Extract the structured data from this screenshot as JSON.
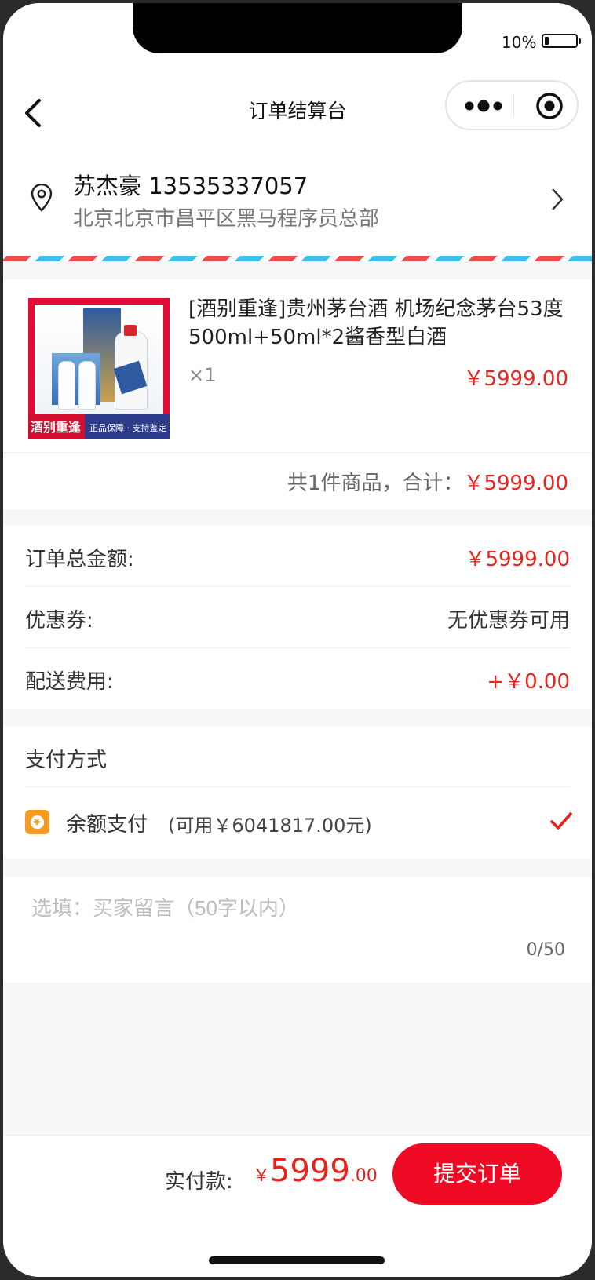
{
  "status": {
    "battery_percent": "10%"
  },
  "nav": {
    "title": "订单结算台"
  },
  "address": {
    "name_phone": "苏杰豪 13535337057",
    "detail": "北京北京市昌平区黑马程序员总部"
  },
  "product": {
    "image_logo_text": "酒别重逢",
    "image_slogan": "正品保障 · 支持鉴定",
    "title": "[酒别重逢]贵州茅台酒 机场纪念茅台53度500ml+50ml*2酱香型白酒",
    "quantity": "×1",
    "price": "￥5999.00"
  },
  "subtotal": {
    "label": "共1件商品，合计：",
    "amount": "￥5999.00"
  },
  "summary": {
    "rows": [
      {
        "label": "订单总金额:",
        "value": "￥5999.00"
      },
      {
        "label": "优惠券:",
        "value": "无优惠券可用"
      },
      {
        "label": "配送费用:",
        "value": "+￥0.00"
      }
    ]
  },
  "payment": {
    "title": "支付方式",
    "method_label": "余额支付",
    "balance_text": "(可用￥6041817.00元)",
    "icon": "wallet-icon",
    "selected": true
  },
  "message": {
    "placeholder": "选填：买家留言（50字以内）",
    "counter": "0/50"
  },
  "footer": {
    "total_label": "实付款:",
    "currency": "￥",
    "total_integer": "5999",
    "total_decimal": ".00",
    "submit_label": "提交订单"
  },
  "colors": {
    "accent_red": "#ee0a24",
    "price_red": "#e8231c",
    "wallet_orange": "#f59a23",
    "airmail_blue": "#3cc1e6",
    "airmail_red": "#ec4d4d"
  }
}
